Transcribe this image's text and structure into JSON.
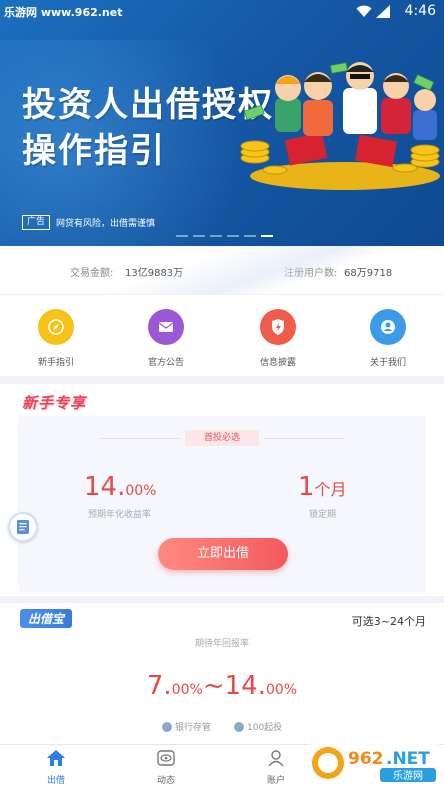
{
  "status_bar": {
    "site": "乐游网 www.962.net",
    "time": "4:46"
  },
  "banner": {
    "title_line1": "投资人出借授权",
    "title_line2": "操作指引",
    "ad_badge": "广告",
    "ad_text": "网贷有风险，出借需谨慎",
    "dots": 6,
    "active_dot": 5
  },
  "stats": {
    "volume_label": "交易金额:",
    "volume_value": "13亿9883万",
    "users_label": "注册用户数:",
    "users_value": "68万9718"
  },
  "menu": {
    "items": [
      {
        "label": "新手指引",
        "icon": "compass-icon",
        "color": "#f6c31a"
      },
      {
        "label": "官方公告",
        "icon": "mail-icon",
        "color": "#9a57d6"
      },
      {
        "label": "信息披露",
        "icon": "shield-icon",
        "color": "#f05c4b"
      },
      {
        "label": "关于我们",
        "icon": "user-circle-icon",
        "color": "#3c9be8"
      }
    ]
  },
  "newbie": {
    "tag": "新手专享",
    "first_tag": "首投必选",
    "rate_value": "14.",
    "rate_unit": "00%",
    "rate_label": "预期年化收益率",
    "lock_value": "1",
    "lock_unit": "个月",
    "lock_label": "锁定期",
    "button": "立即出借"
  },
  "cjb": {
    "tag": "出借宝",
    "range": "可选3~24个月",
    "sub": "期待年回报率",
    "rate_a": "7.",
    "rate_a_unit": "00%",
    "tilde": "~",
    "rate_b": "14.",
    "rate_b_unit": "00%",
    "feature1": "银行存管",
    "feature2": "100起投"
  },
  "tabbar": {
    "items": [
      {
        "label": "出借",
        "icon": "home-icon",
        "active": true
      },
      {
        "label": "动态",
        "icon": "eye-icon",
        "active": false
      },
      {
        "label": "账户",
        "icon": "person-icon",
        "active": false
      }
    ]
  },
  "watermark": {
    "brand": "962",
    "suffix": ".NET",
    "sub": "乐游网"
  },
  "colors": {
    "accent_red": "#e84a4a",
    "accent_blue": "#2f7de1",
    "banner_blue": "#1559a6"
  }
}
